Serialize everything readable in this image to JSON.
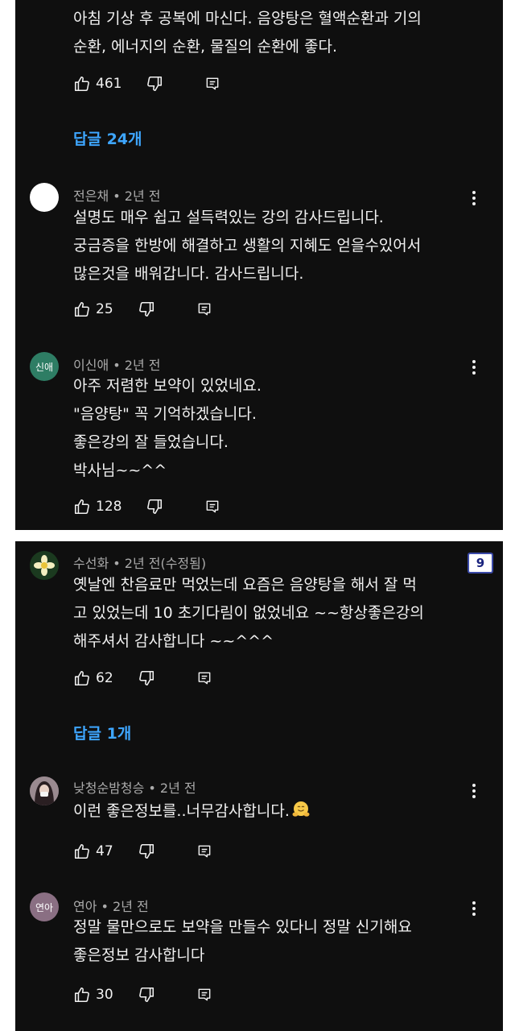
{
  "top_comment": {
    "text_lines": [
      "아침 기상 후 공복에 마신다. 음양탕은 혈액순환과 기의",
      "순환, 에너지의 순환, 물질의 순환에 좋다."
    ],
    "likes": "461"
  },
  "replies_link_1": "답글 24개",
  "replies_1": [
    {
      "author_meta": "전은채 • 2년 전",
      "text_lines": [
        "설명도 매우 쉽고 설득력있는 강의 감사드립니다.",
        "궁금증을 한방에 해결하고 생활의 지혜도 얻을수있어서",
        "많은것을 배워갑니다. 감사드립니다."
      ],
      "likes": "25"
    },
    {
      "avatar_text": "신애",
      "author_meta": "이신애 • 2년 전",
      "text_lines": [
        "아주 저렴한 보약이 있었네요.",
        "\"음양탕\" 꼭 기억하겠습니다.",
        "좋은강의 잘 들었습니다.",
        "박사님~~^^"
      ],
      "likes": "128"
    }
  ],
  "comment_2": {
    "author_meta": "수선화 • 2년 전(수정됨)",
    "badge": "9",
    "text_lines": [
      "옛날엔 찬음료만 먹었는데 요즘은 음양탕을 해서  잘 먹",
      "고 있었는데 10 초기다림이 없었네요 ~~항상좋은강의",
      "해주셔서 감사합니다 ~~^^^"
    ],
    "likes": "62"
  },
  "replies_link_2": "답글 1개",
  "replies_2": [
    {
      "author_meta": "낮청순밤청승 • 2년 전",
      "text": "이런 좋은정보를..너무감사합니다.",
      "emoji": "hugging-face-icon",
      "likes": "47"
    },
    {
      "avatar_text": "연아",
      "author_meta": "연아 • 2년 전",
      "text_lines": [
        "정말 물만으로도 보약을 만들수 있다니 정말 신기해요",
        "좋은정보 감사합니다"
      ],
      "likes": "30"
    }
  ],
  "icons": {
    "like": "thumbs-up-icon",
    "dislike": "thumbs-down-icon",
    "reply": "reply-comment-icon",
    "menu": "kebab-menu-icon"
  },
  "colors": {
    "background": "#0f0f0f",
    "text": "#f1f1f1",
    "meta": "#aaaaaa",
    "link": "#3ea6ff"
  }
}
